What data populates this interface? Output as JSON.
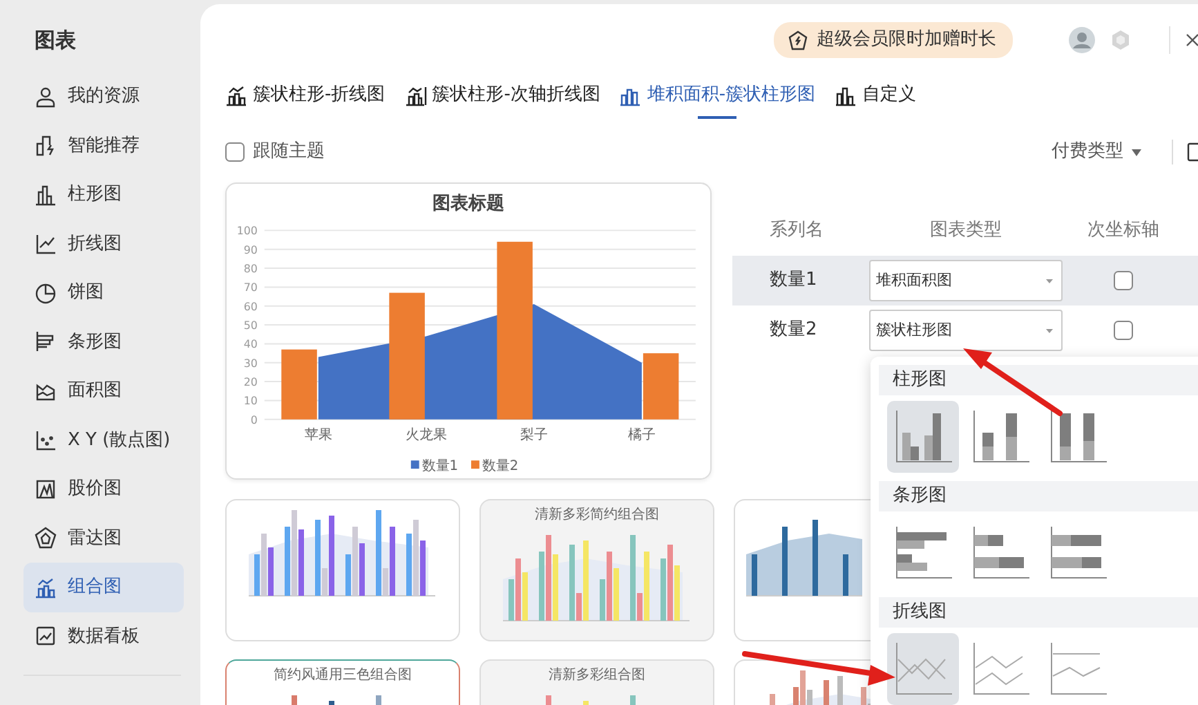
{
  "sidebar": {
    "title": "图表",
    "items": [
      {
        "label": "我的资源",
        "selected": false
      },
      {
        "label": "智能推荐",
        "selected": false
      },
      {
        "label": "柱形图",
        "selected": false
      },
      {
        "label": "折线图",
        "selected": false
      },
      {
        "label": "饼图",
        "selected": false
      },
      {
        "label": "条形图",
        "selected": false
      },
      {
        "label": "面积图",
        "selected": false
      },
      {
        "label": "X Y (散点图)",
        "selected": false
      },
      {
        "label": "股价图",
        "selected": false
      },
      {
        "label": "雷达图",
        "selected": false
      },
      {
        "label": "组合图",
        "selected": true
      },
      {
        "label": "数据看板",
        "selected": false
      }
    ]
  },
  "header": {
    "promo": "超级会员限时加赠时长"
  },
  "tabs": [
    {
      "label": "簇状柱形-折线图",
      "selected": false
    },
    {
      "label": "簇状柱形-次轴折线图",
      "selected": false
    },
    {
      "label": "堆积面积-簇状柱形图",
      "selected": true
    },
    {
      "label": "自定义",
      "selected": false
    }
  ],
  "follow_theme": {
    "label": "跟随主题",
    "checked": false
  },
  "filter": {
    "label": "付费类型"
  },
  "preview": {
    "chart_data": {
      "type": "bar",
      "title": "图表标题",
      "categories": [
        "苹果",
        "火龙果",
        "梨子",
        "橘子"
      ],
      "series": [
        {
          "name": "数量1",
          "color": "#4472c4",
          "type": "area",
          "values": [
            33,
            44,
            61,
            30
          ]
        },
        {
          "name": "数量2",
          "color": "#ed7d31",
          "values": [
            37,
            67,
            94,
            35
          ]
        }
      ],
      "grid": true,
      "legend": true,
      "ylim": [
        0,
        100
      ],
      "yticks": [
        0,
        10,
        20,
        30,
        40,
        50,
        60,
        70,
        80,
        90,
        100
      ]
    }
  },
  "series_table": {
    "columns": [
      "系列名",
      "图表类型",
      "次坐标轴"
    ],
    "rows": [
      {
        "name": "数量1",
        "chart_type": "堆积面积图",
        "secondary_axis": false,
        "highlighted": true
      },
      {
        "name": "数量2",
        "chart_type": "簇状柱形图",
        "secondary_axis": false,
        "highlighted": false
      }
    ]
  },
  "templates": [
    {
      "kind": "blue-purple"
    },
    {
      "kind": "pastel",
      "title": "清新多彩简约组合图"
    },
    {
      "kind": "navy-area"
    },
    {
      "kind": "tricolor",
      "title": "简约风通用三色组合图"
    },
    {
      "kind": "pastel",
      "title": "清新多彩组合图"
    },
    {
      "kind": "plain"
    }
  ],
  "type_menu": {
    "sections": [
      {
        "title": "柱形图",
        "kind": "column",
        "options": [
          {
            "kind": "clustered",
            "selected": true
          },
          {
            "kind": "stacked",
            "selected": false
          },
          {
            "kind": "percent",
            "selected": false
          }
        ]
      },
      {
        "title": "条形图",
        "kind": "bar",
        "options": [
          {
            "kind": "clustered",
            "selected": false
          },
          {
            "kind": "stacked",
            "selected": false
          },
          {
            "kind": "percent",
            "selected": false
          }
        ]
      },
      {
        "title": "折线图",
        "kind": "line",
        "options": [
          {
            "kind": "clustered",
            "selected": true
          },
          {
            "kind": "stacked",
            "selected": false
          },
          {
            "kind": "percent",
            "selected": false
          }
        ]
      }
    ]
  }
}
